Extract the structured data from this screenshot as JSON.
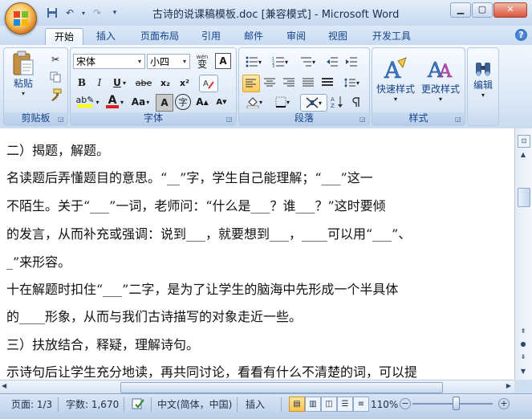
{
  "window": {
    "title": "古诗的说课稿模板.doc [兼容模式] - Microsoft Word",
    "controls": [
      "minimize",
      "maximize",
      "close"
    ]
  },
  "quick_access": {
    "icons": [
      "save-icon",
      "undo-icon",
      "redo-icon",
      "customize-icon"
    ]
  },
  "tabs": [
    {
      "label": "开始",
      "active": true
    },
    {
      "label": "插入"
    },
    {
      "label": "页面布局"
    },
    {
      "label": "引用"
    },
    {
      "label": "邮件"
    },
    {
      "label": "审阅"
    },
    {
      "label": "视图"
    },
    {
      "label": "开发工具"
    }
  ],
  "ribbon": {
    "clipboard": {
      "label": "剪贴板",
      "paste_label": "粘贴"
    },
    "font": {
      "label": "字体",
      "font_name": "宋体",
      "font_size": "小四",
      "wen_label": "wén",
      "bian_label": "变",
      "A_label": "A",
      "bold": "B",
      "italic": "I",
      "underline": "U",
      "strike": "abe",
      "sub": "x₂",
      "sup": "x²",
      "aa": "Aa",
      "grow": "A",
      "shrink": "A",
      "char_shade": "A",
      "char_border": "字"
    },
    "paragraph": {
      "label": "段落"
    },
    "styles": {
      "label": "样式",
      "quick_styles": "快速样式",
      "change_styles": "更改样式"
    },
    "editing": {
      "label": "编辑"
    }
  },
  "document": {
    "lines": [
      "二）揭题，解题。",
      "名读题后弄懂题目的意思。“__”字，学生自己能理解；“___”这一",
      "不陌生。关于“___”一词，老师问：“什么是___？谁___？”这时要倾",
      "的发言，从而补充或强调：说到___，就要想到___，____可以用“___”、",
      "_”来形容。",
      "十在解题时扣住“___”二字，是为了让学生的脑海中先形成一个半具体",
      "的____形象，从而与我们古诗描写的对象走近一些。",
      "三）扶放结合，释疑，理解诗句。",
      "示诗句后让学生充分地读，再共同讨论，看看有什么不清楚的词，可以提"
    ]
  },
  "status": {
    "page": "页面: 1/3",
    "words": "字数: 1,670",
    "language": "中文(简体，中国)",
    "insert_mode": "插入",
    "zoom": "110%",
    "zoom_value": 110
  },
  "colors": {
    "accent": "#15428b",
    "ribbon_bg": "#dde9f7",
    "highlight": "#ffc95a",
    "font_color_red": "#e01e1e",
    "highlight_yellow": "#ffff00"
  }
}
